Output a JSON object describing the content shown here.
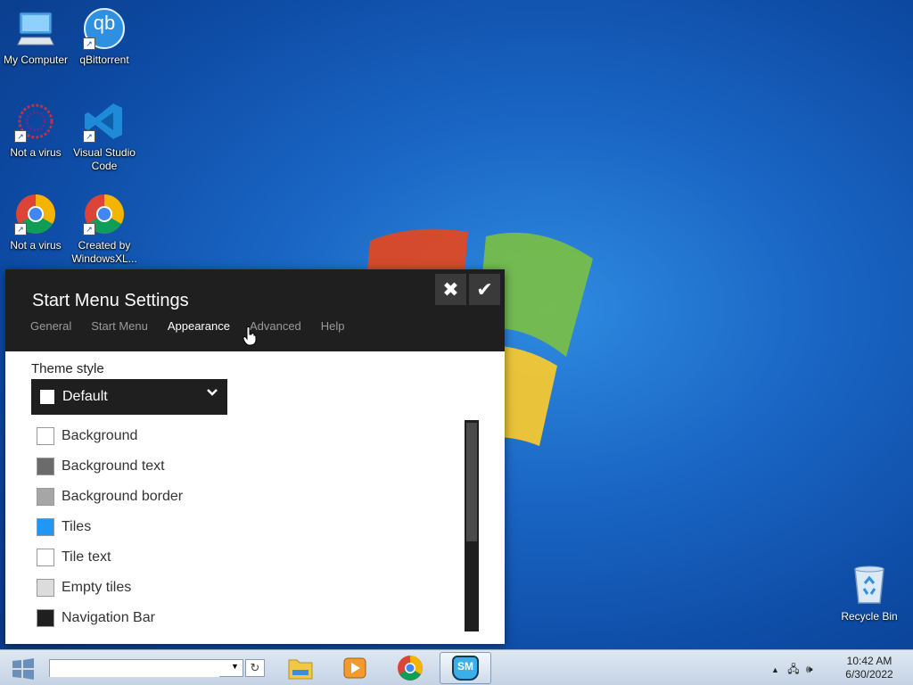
{
  "desktop": {
    "icons": [
      {
        "label": "My Computer",
        "icon": "computer-icon"
      },
      {
        "label": "qBittorrent",
        "icon": "qbittorrent-icon",
        "glyph": "qb"
      },
      {
        "label": "Not a virus",
        "icon": "virus-icon"
      },
      {
        "label": "Visual Studio Code",
        "icon": "vscode-icon"
      },
      {
        "label": "Not a virus",
        "icon": "chrome-icon"
      },
      {
        "label": "Created by WindowsXL...",
        "icon": "chrome-icon"
      }
    ],
    "recycle_bin": {
      "label": "Recycle Bin",
      "icon": "recycle-bin-icon"
    }
  },
  "settings": {
    "title": "Start Menu Settings",
    "close_icon": "close-icon",
    "confirm_icon": "checkmark-icon",
    "tabs": [
      {
        "label": "General",
        "active": false
      },
      {
        "label": "Start Menu",
        "active": false
      },
      {
        "label": "Appearance",
        "active": true
      },
      {
        "label": "Advanced",
        "active": false
      },
      {
        "label": "Help",
        "active": false
      }
    ],
    "theme_style_label": "Theme style",
    "theme_style_value": "Default",
    "colors": [
      {
        "label": "Background",
        "color": "#ffffff"
      },
      {
        "label": "Background text",
        "color": "#6b6b6b"
      },
      {
        "label": "Background border",
        "color": "#a6a6a6"
      },
      {
        "label": "Tiles",
        "color": "#2196f3"
      },
      {
        "label": "Tile text",
        "color": "#ffffff"
      },
      {
        "label": "Empty tiles",
        "color": "#dcdcdc"
      },
      {
        "label": "Navigation Bar",
        "color": "#1f1f1f"
      }
    ]
  },
  "taskbar": {
    "search_value": "",
    "refresh_icon": "refresh-icon",
    "items": [
      {
        "name": "file-explorer",
        "icon": "folder-icon",
        "active": false
      },
      {
        "name": "media-player",
        "icon": "media-player-icon",
        "active": false
      },
      {
        "name": "chrome",
        "icon": "chrome-icon",
        "active": false
      },
      {
        "name": "start-menu-app",
        "icon": "sm-app-icon",
        "glyph": "SM",
        "active": true
      }
    ],
    "time": "10:42 AM",
    "date": "6/30/2022"
  }
}
